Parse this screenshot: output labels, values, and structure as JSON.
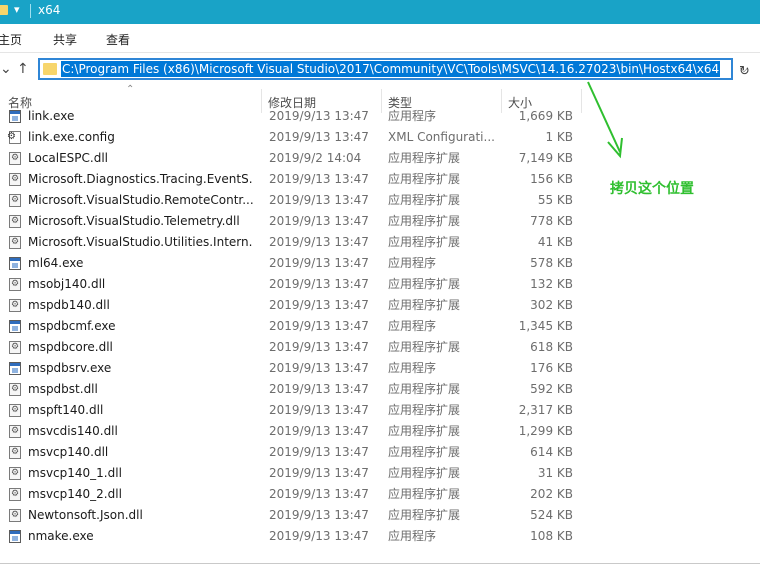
{
  "window": {
    "title": "x64"
  },
  "ribbon": {
    "tabs": [
      "主页",
      "共享",
      "查看"
    ]
  },
  "address": {
    "path": "C:\\Program Files (x86)\\Microsoft Visual Studio\\2017\\Community\\VC\\Tools\\MSVC\\14.16.27023\\bin\\Hostx64\\x64"
  },
  "columns": {
    "name": "名称",
    "modified": "修改日期",
    "type": "类型",
    "size": "大小"
  },
  "files": [
    {
      "name": "link.exe",
      "date": "2019/9/13 13:47",
      "type": "应用程序",
      "size": "1,669 KB",
      "icon": "exe-icon"
    },
    {
      "name": "link.exe.config",
      "date": "2019/9/13 13:47",
      "type": "XML Configurati...",
      "size": "1 KB",
      "icon": "config-icon"
    },
    {
      "name": "LocalESPC.dll",
      "date": "2019/9/2 14:04",
      "type": "应用程序扩展",
      "size": "7,149 KB",
      "icon": "dll-icon"
    },
    {
      "name": "Microsoft.Diagnostics.Tracing.EventS...",
      "date": "2019/9/13 13:47",
      "type": "应用程序扩展",
      "size": "156 KB",
      "icon": "dll-icon"
    },
    {
      "name": "Microsoft.VisualStudio.RemoteContr...",
      "date": "2019/9/13 13:47",
      "type": "应用程序扩展",
      "size": "55 KB",
      "icon": "dll-icon"
    },
    {
      "name": "Microsoft.VisualStudio.Telemetry.dll",
      "date": "2019/9/13 13:47",
      "type": "应用程序扩展",
      "size": "778 KB",
      "icon": "dll-icon"
    },
    {
      "name": "Microsoft.VisualStudio.Utilities.Intern...",
      "date": "2019/9/13 13:47",
      "type": "应用程序扩展",
      "size": "41 KB",
      "icon": "dll-icon"
    },
    {
      "name": "ml64.exe",
      "date": "2019/9/13 13:47",
      "type": "应用程序",
      "size": "578 KB",
      "icon": "exe-icon"
    },
    {
      "name": "msobj140.dll",
      "date": "2019/9/13 13:47",
      "type": "应用程序扩展",
      "size": "132 KB",
      "icon": "dll-icon"
    },
    {
      "name": "mspdb140.dll",
      "date": "2019/9/13 13:47",
      "type": "应用程序扩展",
      "size": "302 KB",
      "icon": "dll-icon"
    },
    {
      "name": "mspdbcmf.exe",
      "date": "2019/9/13 13:47",
      "type": "应用程序",
      "size": "1,345 KB",
      "icon": "exe-icon"
    },
    {
      "name": "mspdbcore.dll",
      "date": "2019/9/13 13:47",
      "type": "应用程序扩展",
      "size": "618 KB",
      "icon": "dll-icon"
    },
    {
      "name": "mspdbsrv.exe",
      "date": "2019/9/13 13:47",
      "type": "应用程序",
      "size": "176 KB",
      "icon": "exe-icon"
    },
    {
      "name": "mspdbst.dll",
      "date": "2019/9/13 13:47",
      "type": "应用程序扩展",
      "size": "592 KB",
      "icon": "dll-icon"
    },
    {
      "name": "mspft140.dll",
      "date": "2019/9/13 13:47",
      "type": "应用程序扩展",
      "size": "2,317 KB",
      "icon": "dll-icon"
    },
    {
      "name": "msvcdis140.dll",
      "date": "2019/9/13 13:47",
      "type": "应用程序扩展",
      "size": "1,299 KB",
      "icon": "dll-icon"
    },
    {
      "name": "msvcp140.dll",
      "date": "2019/9/13 13:47",
      "type": "应用程序扩展",
      "size": "614 KB",
      "icon": "dll-icon"
    },
    {
      "name": "msvcp140_1.dll",
      "date": "2019/9/13 13:47",
      "type": "应用程序扩展",
      "size": "31 KB",
      "icon": "dll-icon"
    },
    {
      "name": "msvcp140_2.dll",
      "date": "2019/9/13 13:47",
      "type": "应用程序扩展",
      "size": "202 KB",
      "icon": "dll-icon"
    },
    {
      "name": "Newtonsoft.Json.dll",
      "date": "2019/9/13 13:47",
      "type": "应用程序扩展",
      "size": "524 KB",
      "icon": "dll-icon"
    },
    {
      "name": "nmake.exe",
      "date": "2019/9/13 13:47",
      "type": "应用程序",
      "size": "108 KB",
      "icon": "exe-icon"
    }
  ],
  "annotation": {
    "text": "拷贝这个位置",
    "color": "#2fbf2f"
  },
  "colors": {
    "titlebar": "#19a3c7",
    "selection": "#0078d7",
    "address_border": "#2f86d6"
  }
}
